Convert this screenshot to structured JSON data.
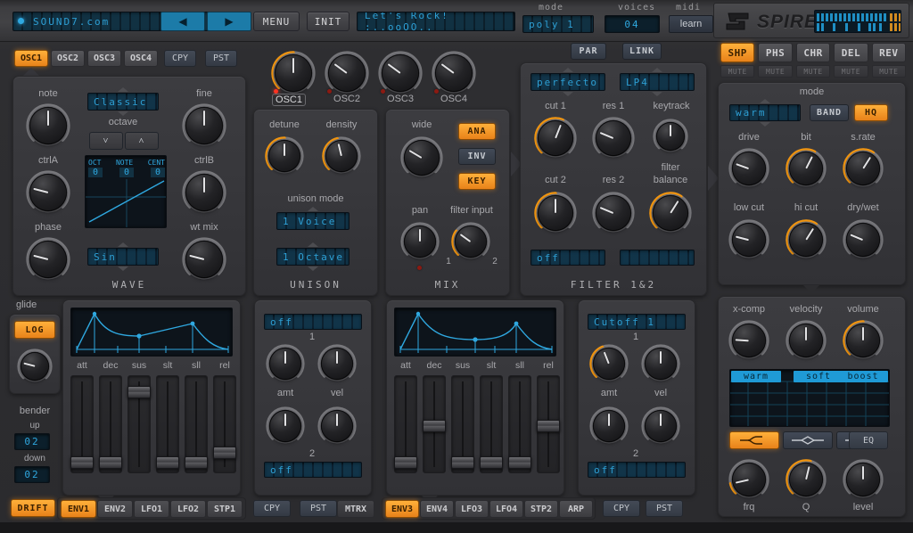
{
  "topbar": {
    "browser_value": "SOUND7.com",
    "nav_prev": "◀",
    "nav_next": "▶",
    "menu_label": "MENU",
    "init_label": "INIT",
    "preset_value": "Let's Rock! :..ooOO..",
    "mode_label": "mode",
    "mode_value": "poly 1",
    "voices_label": "voices",
    "voices_value": "04",
    "midi_label": "midi",
    "midi_learn_label": "learn",
    "logo_text": "SPIRE"
  },
  "fx": {
    "tabs": [
      {
        "label": "SHP",
        "active": true
      },
      {
        "label": "PHS",
        "active": false
      },
      {
        "label": "CHR",
        "active": false
      },
      {
        "label": "DEL",
        "active": false
      },
      {
        "label": "REV",
        "active": false
      }
    ],
    "mute_label": "MUTE",
    "mutes": [
      "MUTE",
      "MUTE",
      "MUTE",
      "MUTE",
      "MUTE"
    ]
  },
  "osc": {
    "tabs": [
      {
        "label": "OSC1",
        "active": true
      },
      {
        "label": "OSC2",
        "active": false
      },
      {
        "label": "OSC3",
        "active": false
      },
      {
        "label": "OSC4",
        "active": false
      }
    ],
    "copy_label": "CPY",
    "paste_label": "PST",
    "algo_value": "Classic",
    "octave_label": "octave",
    "octave_down": "˅",
    "octave_up": "˄",
    "wave_value": "Sin",
    "section_title": "WAVE",
    "knobs": [
      {
        "name": "note",
        "label": "note",
        "value": 0.5
      },
      {
        "name": "fine",
        "label": "fine",
        "value": 0.5
      },
      {
        "name": "ctrlA",
        "label": "ctrlA",
        "value": 0.22
      },
      {
        "name": "ctrlB",
        "label": "ctrlB",
        "value": 0.5
      },
      {
        "name": "phase",
        "label": "phase",
        "value": 0.22
      },
      {
        "name": "wt-mix",
        "label": "wt mix",
        "value": 0.22
      }
    ],
    "tuning_display": {
      "headers": [
        "OCT",
        "NOTE",
        "CENT"
      ],
      "values": [
        "0",
        "0",
        "0"
      ]
    }
  },
  "osc_mix": {
    "oscillators": [
      {
        "label": "OSC1",
        "value": 0.5,
        "led": true,
        "arc": true
      },
      {
        "label": "OSC2",
        "value": 0.3,
        "led": false,
        "arc": false
      },
      {
        "label": "OSC3",
        "value": 0.3,
        "led": false,
        "arc": false
      },
      {
        "label": "OSC4",
        "value": 0.3,
        "led": false,
        "arc": false
      }
    ]
  },
  "unison": {
    "title": "UNISON",
    "detune": {
      "label": "detune",
      "value": 0.5
    },
    "density": {
      "label": "density",
      "value": 0.45
    },
    "mode_label": "unison mode",
    "voice_value": "1 Voice",
    "octave_value": "1 Octave"
  },
  "mix": {
    "title": "MIX",
    "wide": {
      "label": "wide",
      "value": 0.28
    },
    "pan": {
      "label": "pan",
      "value": 0.5
    },
    "filter_input": {
      "label": "filter input",
      "value": 0.3
    },
    "filter_input_min": "1",
    "filter_input_max": "2",
    "ana_label": "ANA",
    "inv_label": "INV",
    "key_label": "KEY",
    "ana_on": true,
    "inv_on": false,
    "key_on": true
  },
  "filter": {
    "title": "FILTER 1&2",
    "par_label": "PAR",
    "link_label": "LINK",
    "preset_value": "perfecto",
    "type_value": "LP4",
    "cut1": {
      "label": "cut 1",
      "value": 0.58
    },
    "res1": {
      "label": "res 1",
      "value": 0.25
    },
    "keytrack": {
      "label": "keytrack",
      "value": 0.5
    },
    "cut2": {
      "label": "cut 2",
      "value": 0.5
    },
    "res2": {
      "label": "res 2",
      "value": 0.25
    },
    "filter_balance": {
      "label": "filter\nbalance",
      "label1": "filter",
      "label2": "balance",
      "value": 0.62
    },
    "mod1_value": "off",
    "mod2_value": ""
  },
  "shaper": {
    "mode_label": "mode",
    "mode_value": "warm",
    "band_label": "BAND",
    "hq_label": "HQ",
    "band_on": false,
    "hq_on": true,
    "knobs": [
      {
        "name": "drive",
        "label": "drive",
        "value": 0.24,
        "arc": false
      },
      {
        "name": "bit",
        "label": "bit",
        "value": 0.6,
        "arc": true
      },
      {
        "name": "s-rate",
        "label": "s.rate",
        "value": 0.62,
        "arc": true
      },
      {
        "name": "low-cut",
        "label": "low cut",
        "value": 0.22,
        "arc": false
      },
      {
        "name": "hi-cut",
        "label": "hi cut",
        "value": 0.62,
        "arc": true
      },
      {
        "name": "dry-wet",
        "label": "dry/wet",
        "value": 0.25,
        "arc": false
      }
    ]
  },
  "master": {
    "x_comp": {
      "label": "x-comp",
      "value": 0.18
    },
    "velocity": {
      "label": "velocity",
      "value": 0.5
    },
    "volume": {
      "label": "volume",
      "value": 0.5
    },
    "eq_bands": [
      "warm",
      "soft",
      "boost"
    ],
    "shape_buttons": [
      "shelf-low",
      "bell",
      "shelf-high"
    ],
    "active_shape": 0,
    "eq_label": "EQ",
    "frq": {
      "label": "frq",
      "value": 0.12
    },
    "q": {
      "label": "Q",
      "value": 0.55
    },
    "level": {
      "label": "level",
      "value": 0.5
    }
  },
  "glide": {
    "label": "glide",
    "mode_value": "LOG",
    "amount": 0.22,
    "bender_label": "bender",
    "up_label": "up",
    "up_value": "02",
    "down_label": "down",
    "down_value": "02",
    "drift_label": "DRIFT"
  },
  "env1": {
    "stage_labels": [
      "att",
      "dec",
      "sus",
      "slt",
      "sll",
      "rel"
    ],
    "values": [
      0.04,
      0.04,
      0.92,
      0.04,
      0.04,
      0.17
    ],
    "tabs": [
      {
        "label": "ENV1",
        "active": true
      },
      {
        "label": "ENV2",
        "active": false
      },
      {
        "label": "LFO1",
        "active": false
      },
      {
        "label": "LFO2",
        "active": false
      },
      {
        "label": "STP1",
        "active": false
      }
    ],
    "copy_label": "CPY",
    "paste_label": "PST"
  },
  "mod1": {
    "dest1_value": "off",
    "dest2_value": "off",
    "amt_label": "amt",
    "vel_label": "vel",
    "num1": "1",
    "num2": "2",
    "amt1": 0.5,
    "vel1": 0.5,
    "amt2": 0.5,
    "vel2": 0.5,
    "mtrx_label": "MTRX"
  },
  "env3": {
    "stage_labels": [
      "att",
      "dec",
      "sus",
      "slt",
      "sll",
      "rel"
    ],
    "values": [
      0.04,
      0.5,
      0.04,
      0.04,
      0.04,
      0.5
    ],
    "tabs": [
      {
        "label": "ENV3",
        "active": true
      },
      {
        "label": "ENV4",
        "active": false
      },
      {
        "label": "LFO3",
        "active": false
      },
      {
        "label": "LFO4",
        "active": false
      },
      {
        "label": "STP2",
        "active": false
      },
      {
        "label": "ARP",
        "active": false
      }
    ],
    "copy_label": "CPY",
    "paste_label": "PST"
  },
  "mod2": {
    "dest1_value": "Cutoff 1",
    "dest2_value": "off",
    "amt_label": "amt",
    "vel_label": "vel",
    "num1": "1",
    "num2": "2",
    "amt1": 0.42,
    "vel1": 0.5,
    "amt2": 0.5,
    "vel2": 0.5
  },
  "colors": {
    "accent": "#ef8e16",
    "lcd": "#2fa8e0",
    "panel": "#37373b",
    "led_on": "#ff3322"
  }
}
